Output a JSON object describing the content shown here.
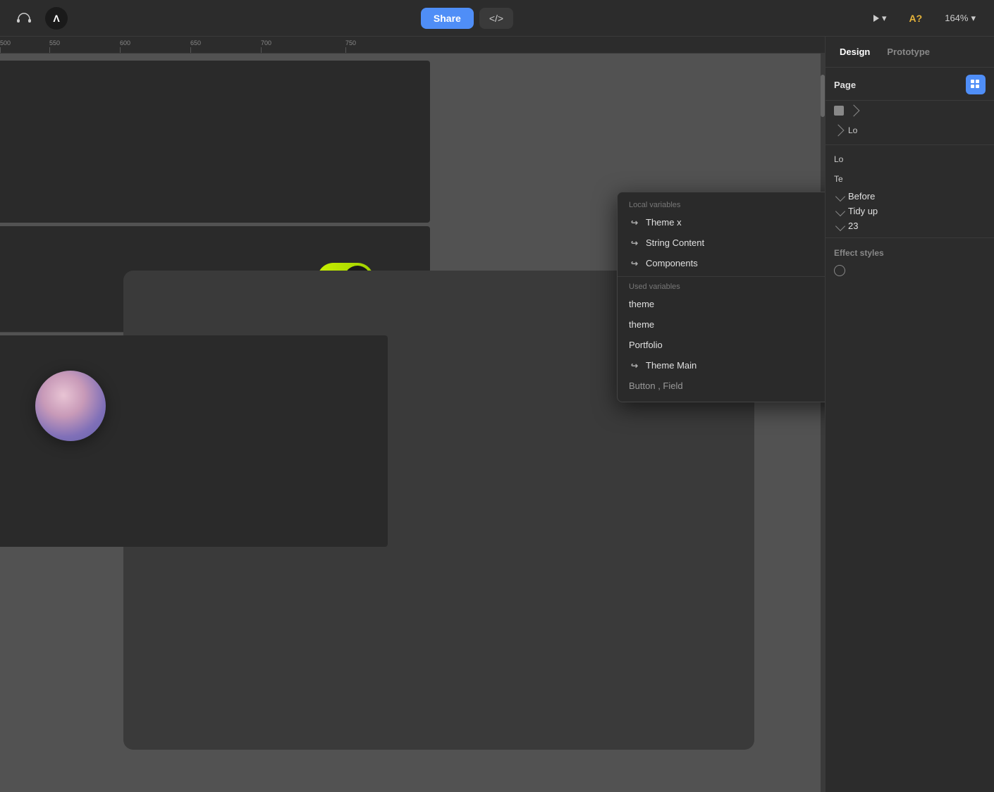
{
  "topbar": {
    "share_label": "Share",
    "code_label": "</>",
    "play_label": "▷",
    "play_dropdown": "▾",
    "a_check_label": "A?",
    "zoom_label": "164%",
    "zoom_dropdown": "▾",
    "logo_label": "Λ"
  },
  "ruler": {
    "marks": [
      "500",
      "550",
      "600",
      "650",
      "700",
      "750"
    ]
  },
  "right_panel": {
    "tabs": [
      {
        "label": "Design",
        "active": true
      },
      {
        "label": "Prototype",
        "active": false
      }
    ],
    "page_title": "Page",
    "partial_row1": "Lo",
    "partial_row2": "Lo",
    "partial_row3": "Te",
    "row_before_label": "Before",
    "row_tidy_label": "Tidy up",
    "row_23_label": "23",
    "partial_button_field": "Button , Field",
    "effect_styles_label": "Effect styles"
  },
  "dropdown": {
    "local_variables_label": "Local variables",
    "items_local": [
      {
        "label": "Theme x",
        "indent": true
      },
      {
        "label": "String Content",
        "indent": true
      },
      {
        "label": "Components",
        "indent": true
      }
    ],
    "used_variables_label": "Used variables",
    "items_used": [
      {
        "label": "theme",
        "indent": false
      },
      {
        "label": "theme",
        "indent": false
      },
      {
        "label": "Portfolio",
        "indent": false
      },
      {
        "label": "Theme Main",
        "indent": true
      }
    ],
    "partial_item": "Button , Field"
  }
}
